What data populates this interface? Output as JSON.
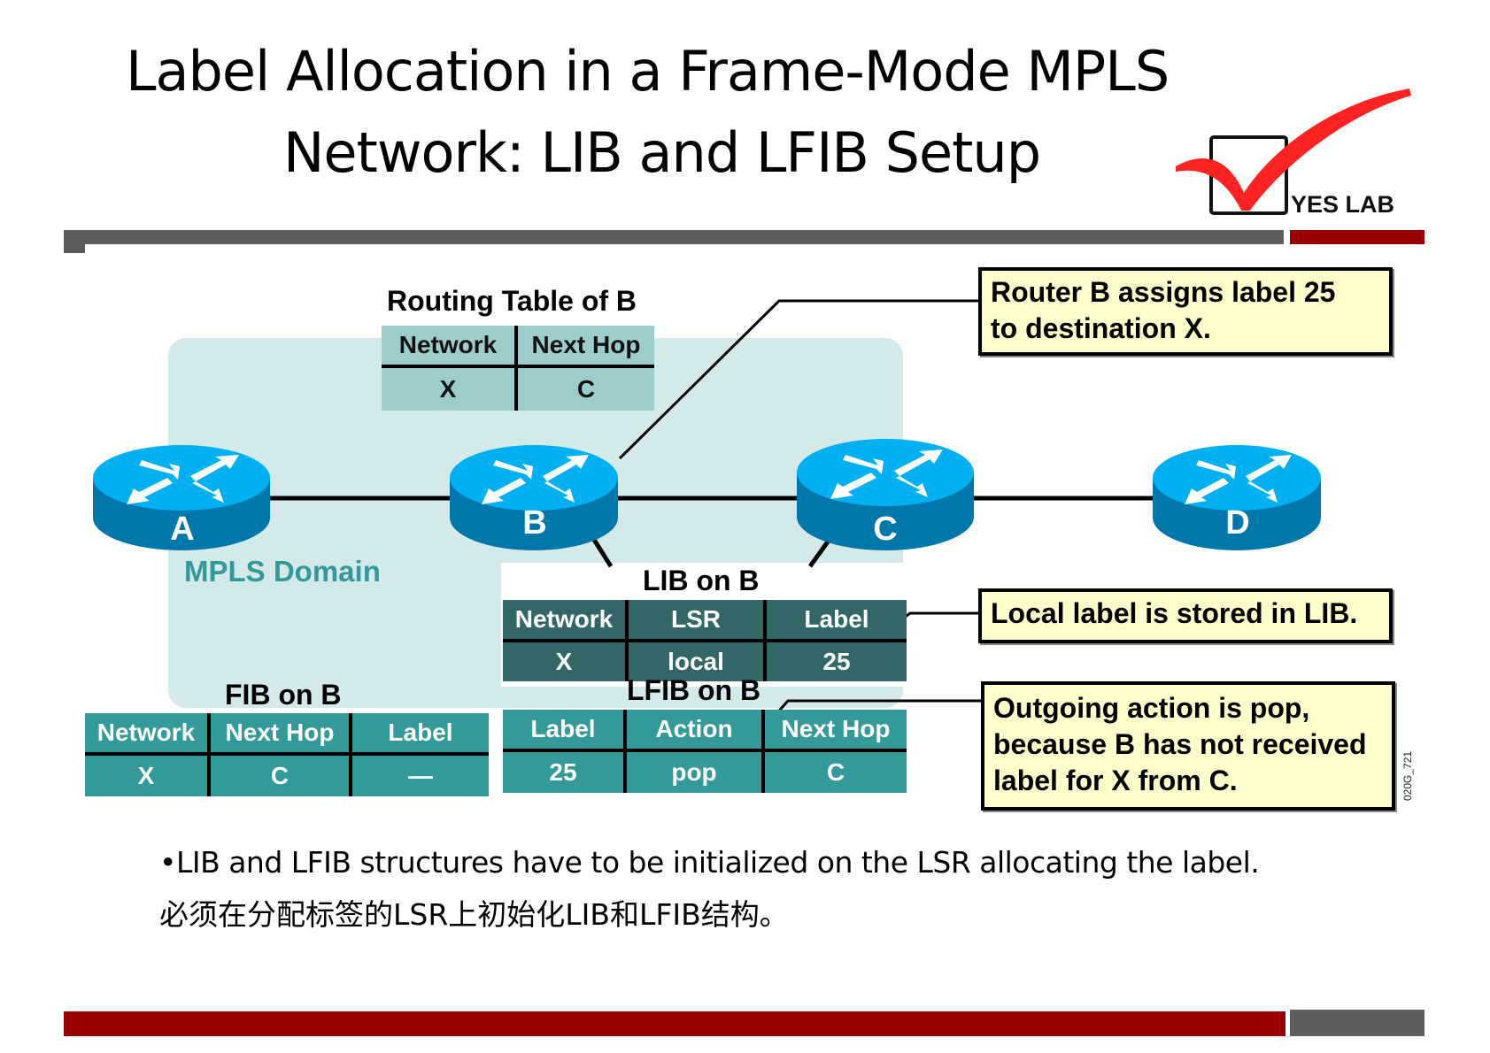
{
  "header": {
    "title_line1": "Label Allocation in a Frame-Mode MPLS",
    "title_line2": "Network: LIB and LFIB Setup",
    "logo_text": "YES LAB"
  },
  "colors": {
    "header_bar_gray": "#5c5e5b",
    "accent_red": "#9b0000",
    "router_top": "#00b0f0",
    "router_side": "#0077aa",
    "domain_bg": "#d4e9ea",
    "callout_bg": "#ffffcc",
    "teal": "#339999",
    "dark_teal": "#336666",
    "light_teal": "#9ccccc"
  },
  "diagram": {
    "domain_label": "MPLS Domain",
    "routers": [
      {
        "name": "A"
      },
      {
        "name": "B"
      },
      {
        "name": "C"
      },
      {
        "name": "D"
      }
    ],
    "routing_table": {
      "title": "Routing Table of B",
      "headers": [
        "Network",
        "Next Hop"
      ],
      "rows": [
        [
          "X",
          "C"
        ]
      ]
    },
    "lib": {
      "title": "LIB on B",
      "headers": [
        "Network",
        "LSR",
        "Label"
      ],
      "rows": [
        [
          "X",
          "local",
          "25"
        ]
      ]
    },
    "lfib": {
      "title": "LFIB on B",
      "headers": [
        "Label",
        "Action",
        "Next Hop"
      ],
      "rows": [
        [
          "25",
          "pop",
          "C"
        ]
      ]
    },
    "fib": {
      "title": "FIB on B",
      "headers": [
        "Network",
        "Next Hop",
        "Label"
      ],
      "rows": [
        [
          "X",
          "C",
          "—"
        ]
      ]
    },
    "callouts": [
      {
        "text_line1": "Router B assigns label 25",
        "text_line2": "to destination X."
      },
      {
        "text_line1": "Local label is stored in LIB."
      },
      {
        "text_line1": "Outgoing action is pop,",
        "text_line2": "because B has not received",
        "text_line3": "label for X from C."
      }
    ],
    "figure_id": "020G_721"
  },
  "body": {
    "bullet": "•LIB and LFIB structures have to be initialized on the LSR allocating the  label.",
    "chinese": "必须在分配标签的LSR上初始化LIB和LFIB结构。"
  }
}
